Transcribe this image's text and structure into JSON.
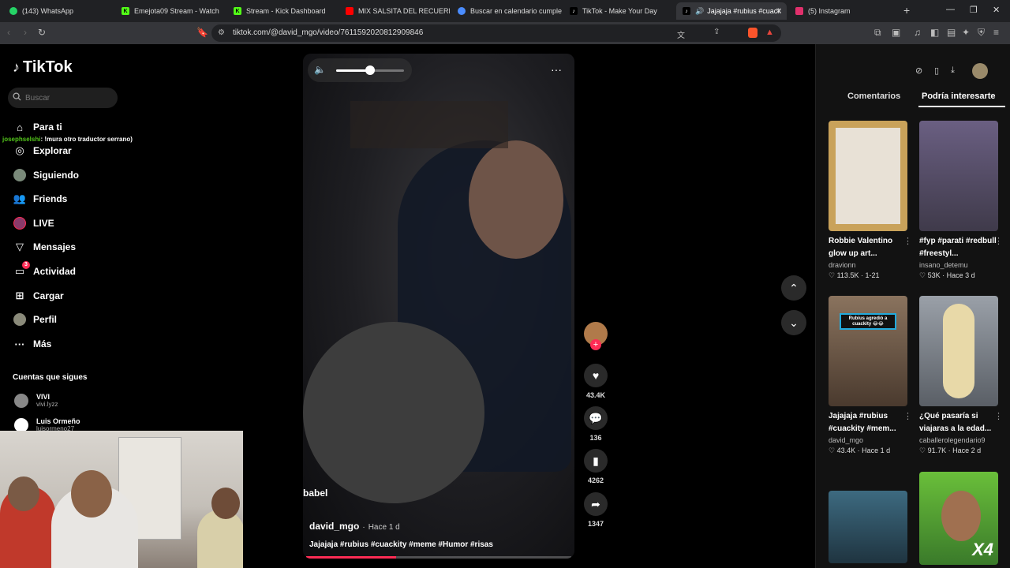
{
  "browser": {
    "tabs": [
      {
        "title": "(143) WhatsApp",
        "icon": "whatsapp-icon",
        "color": "#25d366"
      },
      {
        "title": "Emejota09 Stream - Watch",
        "icon": "kick-icon",
        "color": "#53fc18"
      },
      {
        "title": "Stream - Kick Dashboard",
        "icon": "kick-icon",
        "color": "#53fc18"
      },
      {
        "title": "MIX SALSITA DEL RECUERD",
        "icon": "youtube-icon",
        "color": "#ff0000"
      },
      {
        "title": "Buscar en calendario cumplea",
        "icon": "calendar-icon",
        "color": "#4a8cff"
      },
      {
        "title": "TikTok - Make Your Day",
        "icon": "tiktok-icon",
        "color": "#ffffff"
      },
      {
        "title": "Jajajaja #rubius #cuack",
        "icon": "tiktok-icon",
        "color": "#ffffff"
      },
      {
        "title": "(5) Instagram",
        "icon": "instagram-icon",
        "color": "#e1306c"
      }
    ],
    "url": "tiktok.com/@david_mgo/video/7611592020812909846"
  },
  "sidebar": {
    "logo": "TikTok",
    "search_placeholder": "Buscar",
    "items": [
      {
        "label": "Para ti",
        "icon": "home-icon"
      },
      {
        "label": "Explorar",
        "icon": "compass-icon"
      },
      {
        "label": "Siguiendo",
        "icon": "avatar-icon"
      },
      {
        "label": "Friends",
        "icon": "friends-icon"
      },
      {
        "label": "LIVE",
        "icon": "live-icon"
      },
      {
        "label": "Mensajes",
        "icon": "send-icon"
      },
      {
        "label": "Actividad",
        "icon": "activity-icon",
        "badge": "3"
      },
      {
        "label": "Cargar",
        "icon": "upload-icon"
      },
      {
        "label": "Perfil",
        "icon": "profile-icon"
      },
      {
        "label": "Más",
        "icon": "more-icon"
      }
    ],
    "following_title": "Cuentas que sigues",
    "following": [
      {
        "name": "VIVI",
        "handle": "vivi.lyzz"
      },
      {
        "name": "Luis Ormeño",
        "handle": "luisormeno27"
      }
    ]
  },
  "chat_overlay": {
    "user": "josephselshi",
    "message": ": !mura otro traductor serrano)"
  },
  "video": {
    "username": "david_mgo",
    "time": "Hace 1 d",
    "caption": "Jajajaja #rubius #cuackity #meme #Humor #risas",
    "overlay_text": "babel",
    "volume": 0.5,
    "progress": 0.34,
    "likes": "43.4K",
    "comments": "136",
    "saves": "4262",
    "shares": "1347"
  },
  "right_panel": {
    "tabs": [
      "Comentarios",
      "Podría interesarte"
    ],
    "active_tab": "Podría interesarte",
    "cards": [
      {
        "title": "Robbie Valentino glow up art...",
        "user": "dravionn",
        "likes": "113.5K",
        "date": "1-21",
        "thumb_color": "#c9a25a"
      },
      {
        "title": "#fyp #parati #redbull #freestyl...",
        "user": "insano_detemu",
        "likes": "53K",
        "date": "Hace 3 d",
        "thumb_color": "#5a4f6a"
      },
      {
        "title": "Jajajaja #rubius #cuackity #mem...",
        "user": "david_mgo",
        "likes": "43.4K",
        "date": "Hace 1 d",
        "thumb_color": "#6b5a4a",
        "thumb_text": "Rubius agredió a cuackity 😂😂"
      },
      {
        "title": "¿Qué pasaría si viajaras a la edad...",
        "user": "caballerolegendario9",
        "likes": "91.7K",
        "date": "Hace 2 d",
        "thumb_color": "#7a7f86"
      },
      {
        "title": "",
        "user": "",
        "likes": "",
        "date": "",
        "thumb_color": "#2e4a5a"
      },
      {
        "title": "",
        "user": "",
        "likes": "",
        "date": "",
        "thumb_color": "#6abf3a",
        "thumb_text": "X4"
      }
    ]
  }
}
